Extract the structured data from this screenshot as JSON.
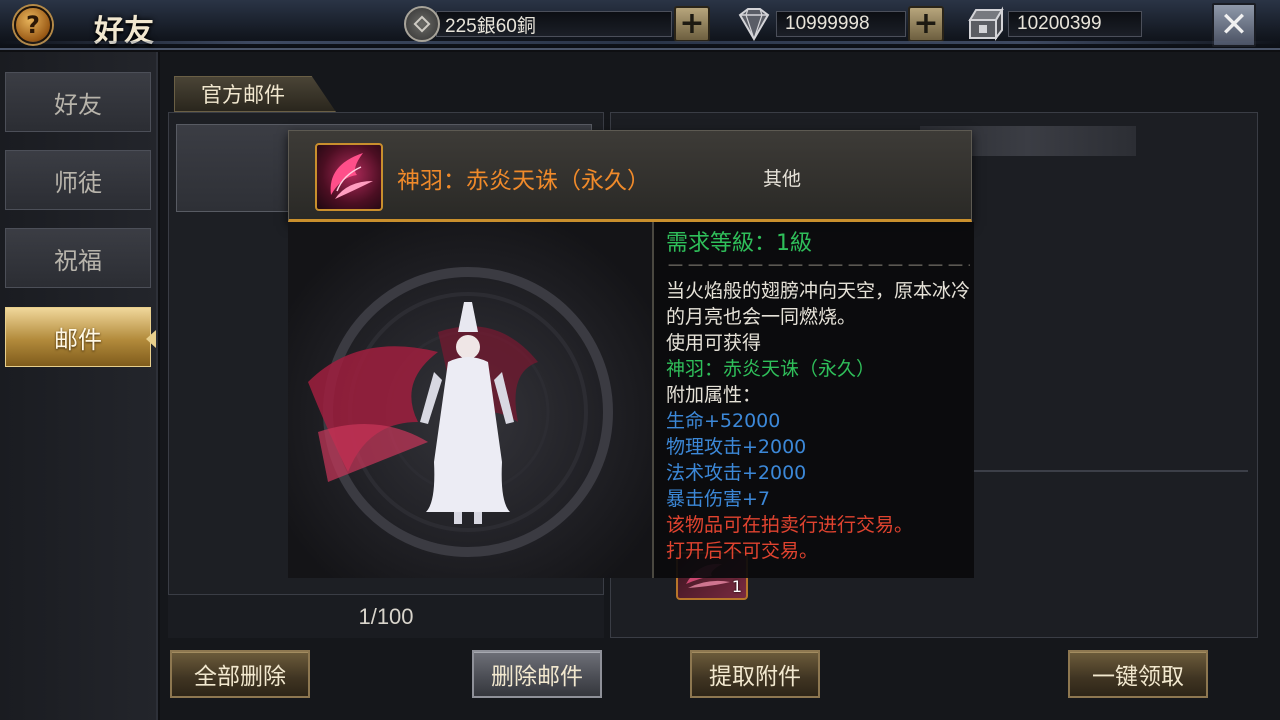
{
  "header": {
    "help_glyph": "?",
    "title": "好友",
    "silver": "225銀60銅",
    "gems": "10999998",
    "tokens": "10200399",
    "close_glyph": "✕",
    "plus_glyph": "+"
  },
  "sidebar": {
    "items": [
      {
        "label": "好友"
      },
      {
        "label": "师徒"
      },
      {
        "label": "祝福"
      },
      {
        "label": "邮件"
      }
    ]
  },
  "mail": {
    "tab_label": "官方邮件",
    "counter": "1/100",
    "attachment_count": "1"
  },
  "tooltip": {
    "item_name": "神羽：赤炎天诛（永久）",
    "item_type": "其他",
    "required_level": "需求等級：1級",
    "separator": "－－－－－－－－－－－－－－－－－－－－－",
    "description": "当火焰般的翅膀冲向天空，原本冰冷的月亮也会一同燃烧。",
    "use_prefix": "使用可获得",
    "use_item": "神羽：赤炎天诛（永久）",
    "bonus_title": "附加属性：",
    "stats": [
      "生命+52000",
      "物理攻击+2000",
      "法术攻击+2000",
      "暴击伤害+7"
    ],
    "notes": [
      "该物品可在拍卖行进行交易。",
      "打开后不可交易。"
    ]
  },
  "buttons": {
    "delete_all": "全部删除",
    "delete_mail": "删除邮件",
    "take_attachment": "提取附件",
    "claim_all": "一键领取"
  },
  "colors": {
    "item_name": "#f08a2a",
    "requirement": "#2fbf5a",
    "stat": "#3c88d8",
    "warning": "#e0432f",
    "active_tab": "#b28a3b"
  }
}
